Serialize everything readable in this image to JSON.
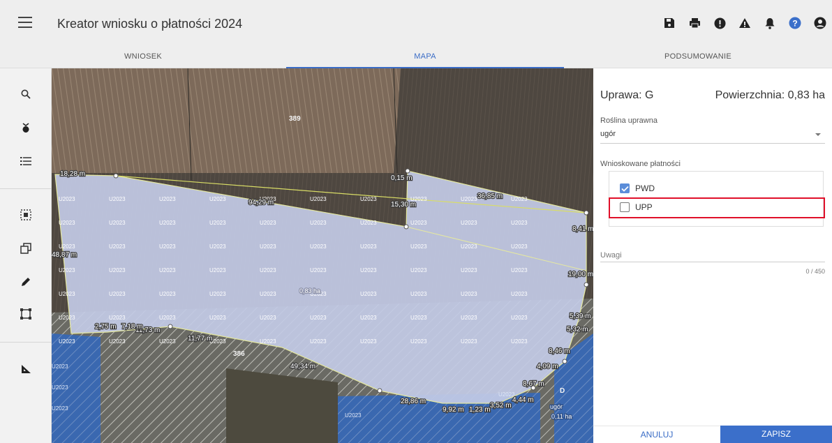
{
  "header": {
    "title": "Kreator wniosku o płatności 2024",
    "icons": [
      "save-icon",
      "print-icon",
      "info-alert-icon",
      "warning-icon",
      "notification-bell-icon",
      "help-icon",
      "account-icon"
    ]
  },
  "tabs": [
    {
      "label": "WNIOSEK",
      "active": false
    },
    {
      "label": "MAPA",
      "active": true
    },
    {
      "label": "PODSUMOWANIE",
      "active": false
    }
  ],
  "toolbar": {
    "tools": [
      "search-icon",
      "crop-marker-icon",
      "layers-list-icon",
      "select-area-icon",
      "copy-shape-icon",
      "edit-pencil-icon",
      "draw-rectangle-icon",
      "measure-icon"
    ]
  },
  "map": {
    "parcel_labels": [
      "389",
      "386",
      "D"
    ],
    "fill_label": "U2023",
    "area_label": "0,83 ha",
    "small_area_label": "0,11 ha",
    "side_crop_label": "ugór",
    "dimension_labels": [
      "18,28 m",
      "0,15 m",
      "36,85 m",
      "15,30 m",
      "8,41 m",
      "48,87 m",
      "19,00 m",
      "5,39 m",
      "5,32 m",
      "8,46 m",
      "4,09 m",
      "8,67 m",
      "4,44 m",
      "11,73 m",
      "11,77 m",
      "2,75 m",
      "7,18 m",
      "49,34 m",
      "28,86 m",
      "9,92 m",
      "1,23 m",
      "3,52 m",
      "94,29 m"
    ]
  },
  "panel": {
    "crop_title": "Uprawa: G",
    "area_title": "Powierzchnia: 0,83 ha",
    "plant_label": "Roślina uprawna",
    "plant_value": "ugór",
    "payments_label": "Wnioskowane płatności",
    "payments": [
      {
        "label": "PWD",
        "checked": true
      },
      {
        "label": "UPP",
        "checked": false
      }
    ],
    "notes_label": "Uwagi",
    "notes_counter": "0 / 450",
    "cancel_label": "ANULUJ",
    "save_label": "ZAPISZ"
  },
  "colors": {
    "accent": "#3b6fca",
    "highlight": "#e0102a",
    "parcel_fill": "#c3cbe6",
    "water_blue": "#3a68b0"
  }
}
